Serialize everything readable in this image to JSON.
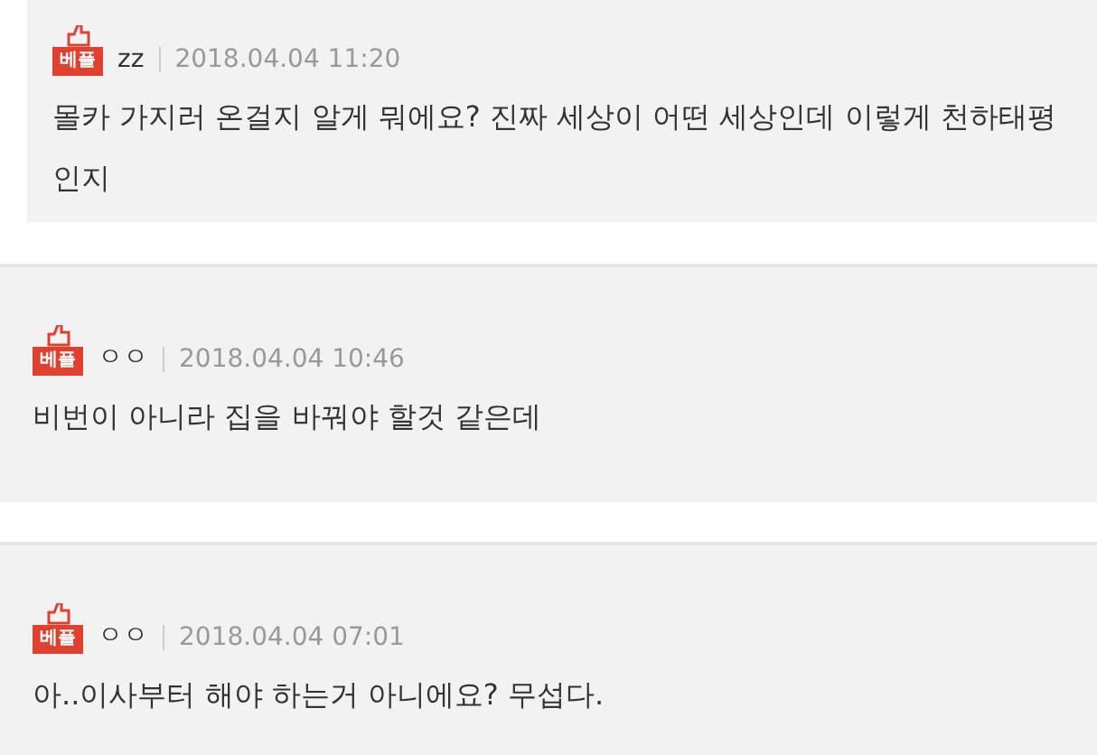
{
  "comments": [
    {
      "badge": "베플",
      "author": "zz",
      "time": "2018.04.04 11:20",
      "text": "몰카 가지러 온걸지 알게 뭐에요? 진짜 세상이 어떤 세상인데 이렇게 천하태평인지"
    },
    {
      "badge": "베플",
      "author": "ㅇㅇ",
      "time": "2018.04.04 10:46",
      "text": "비번이 아니라 집을 바꿔야 할것 같은데"
    },
    {
      "badge": "베플",
      "author": "ㅇㅇ",
      "time": "2018.04.04 07:01",
      "text": "아..이사부터 해야 하는거 아니에요? 무섭다."
    }
  ]
}
